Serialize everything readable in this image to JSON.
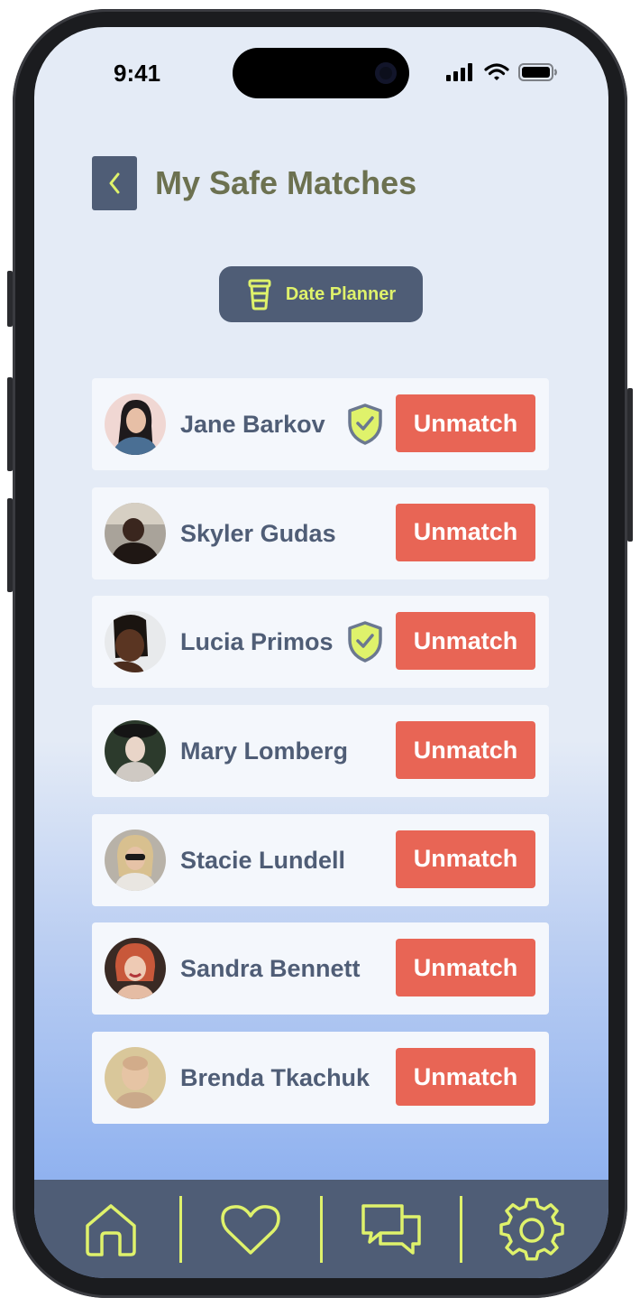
{
  "status_bar": {
    "time": "9:41"
  },
  "header": {
    "title": "My Safe Matches",
    "back_icon": "chevron-left-icon"
  },
  "planner_button": {
    "label": "Date Planner",
    "icon": "coffee-cup-icon"
  },
  "matches": [
    {
      "name": "Jane Barkov",
      "verified": true,
      "action": "Unmatch"
    },
    {
      "name": "Skyler Gudas",
      "verified": false,
      "action": "Unmatch"
    },
    {
      "name": "Lucia Primos",
      "verified": true,
      "action": "Unmatch"
    },
    {
      "name": "Mary Lomberg",
      "verified": false,
      "action": "Unmatch"
    },
    {
      "name": "Stacie Lundell",
      "verified": false,
      "action": "Unmatch"
    },
    {
      "name": "Sandra Bennett",
      "verified": false,
      "action": "Unmatch"
    },
    {
      "name": "Brenda Tkachuk",
      "verified": false,
      "action": "Unmatch"
    }
  ],
  "bottom_nav": {
    "items": [
      "home-icon",
      "heart-icon",
      "chat-icon",
      "settings-gear-icon"
    ]
  },
  "colors": {
    "accent": "#dff26b",
    "slate": "#4f5d76",
    "unmatch": "#e86555",
    "title": "#6c7150"
  }
}
